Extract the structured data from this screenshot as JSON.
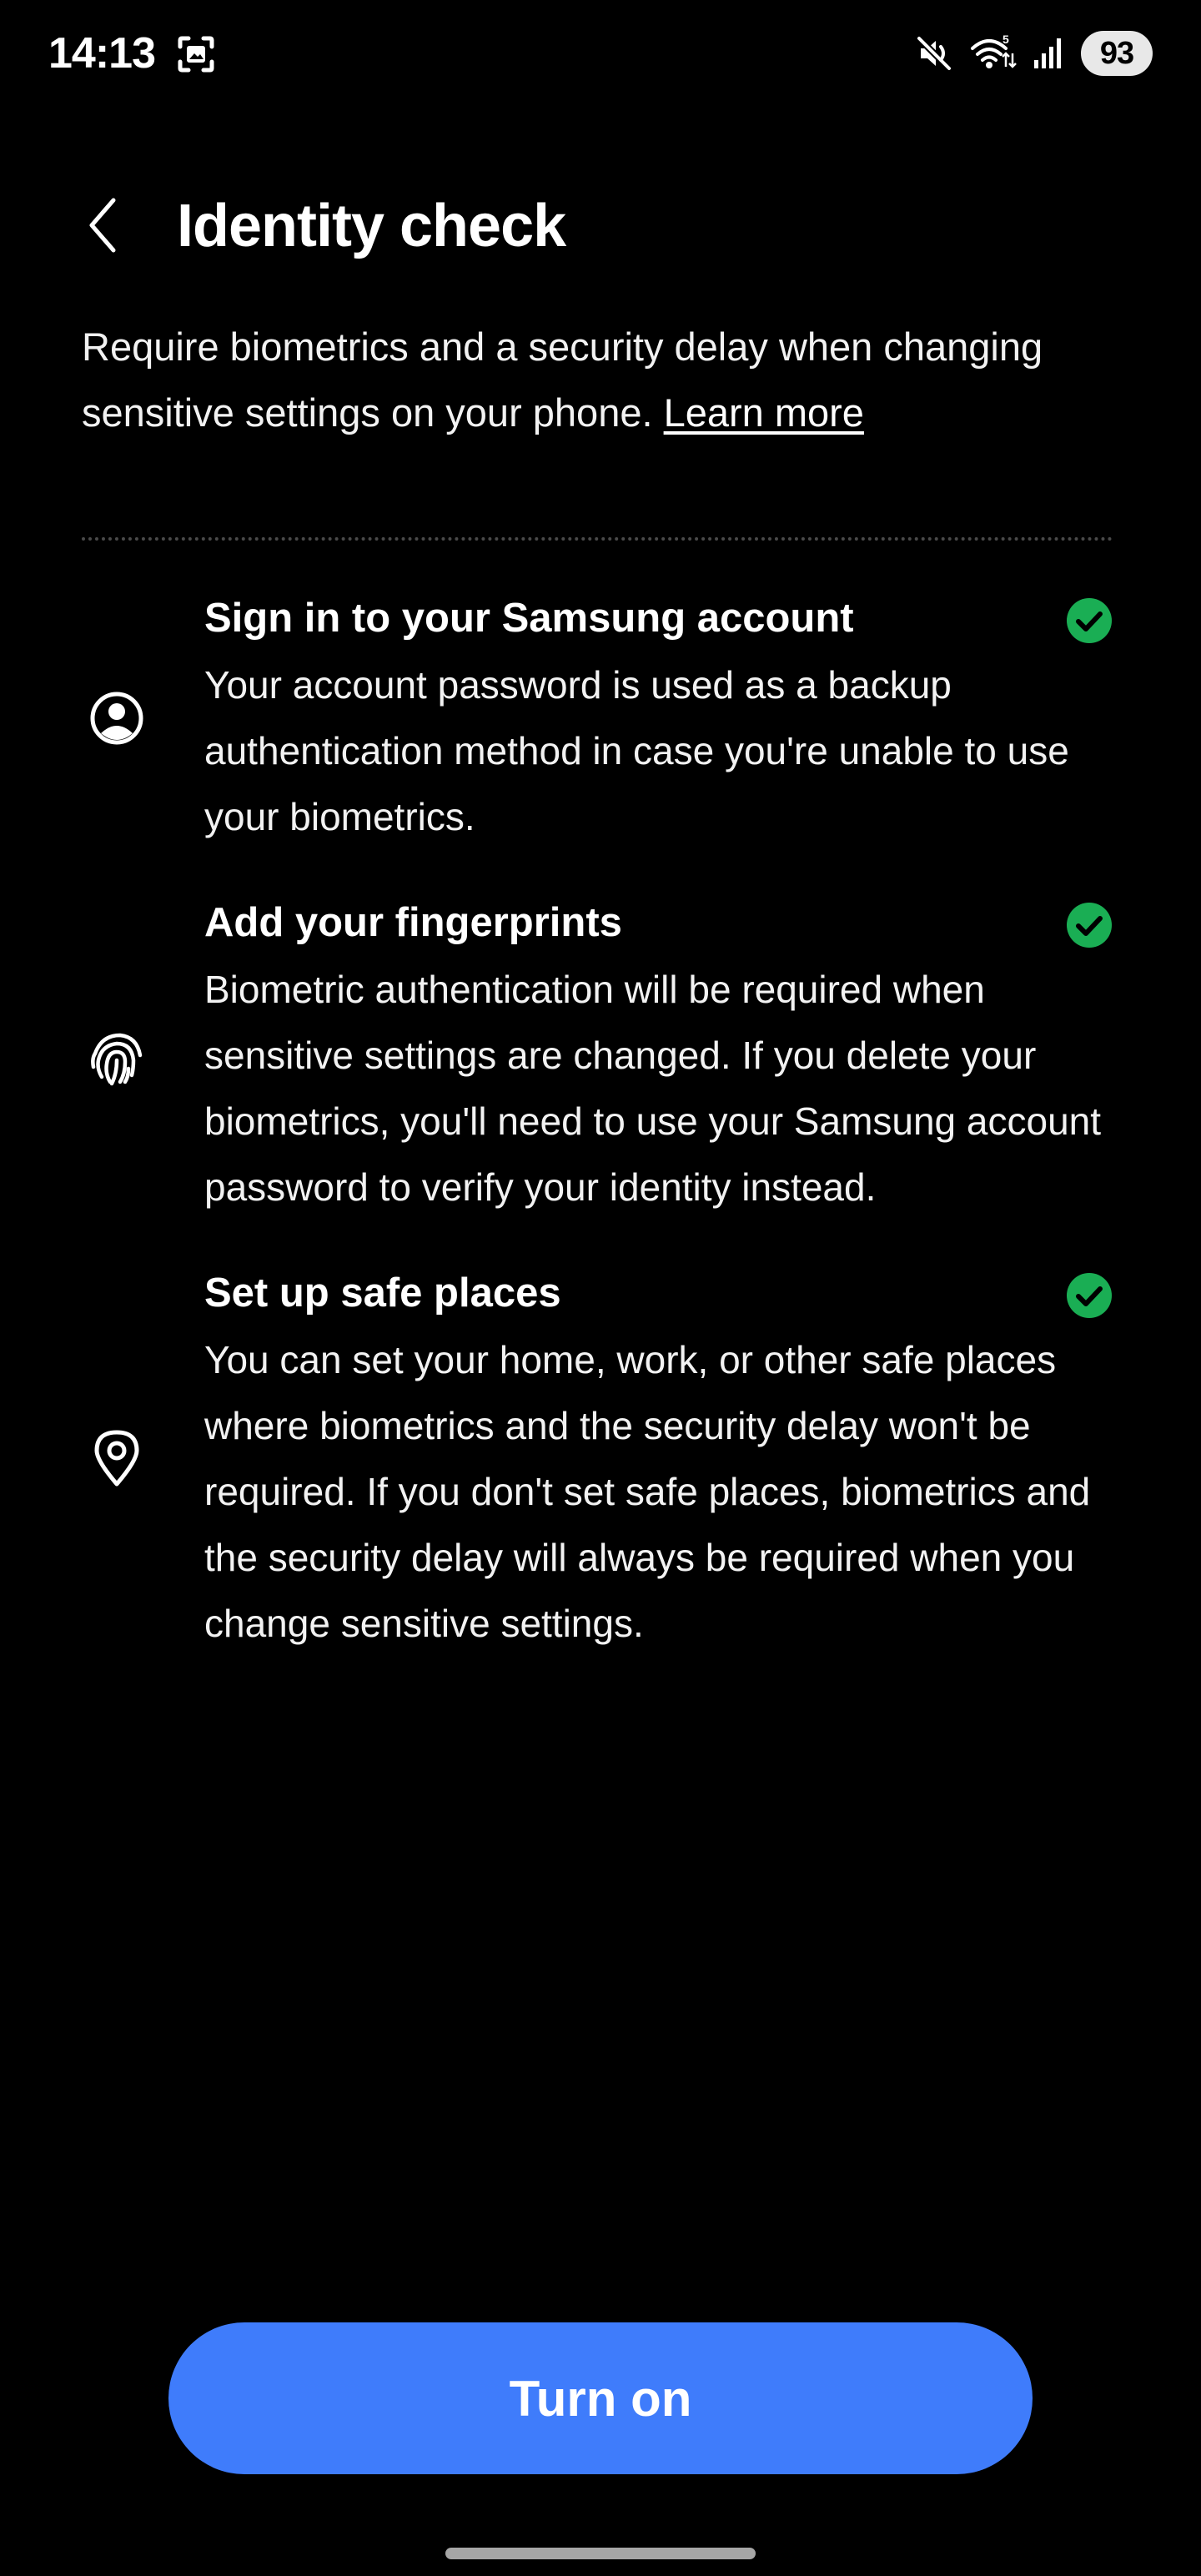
{
  "status_bar": {
    "time": "14:13",
    "battery": "93",
    "icons": [
      "screenshot-icon",
      "mute-icon",
      "wifi-icon",
      "signal-icon",
      "battery-icon"
    ]
  },
  "header": {
    "back_icon": "chevron-left-icon",
    "title": "Identity check"
  },
  "description": {
    "text": "Require biometrics and a security delay when changing sensitive settings on your phone.",
    "learn_more": "Learn more"
  },
  "requirements": [
    {
      "icon": "account-icon",
      "title": "Sign in to your Samsung account",
      "description": "Your account password is used as a backup authentication method in case you're unable to use your biometrics.",
      "status": "complete"
    },
    {
      "icon": "fingerprint-icon",
      "title": "Add your fingerprints",
      "description": "Biometric authentication will be required when sensitive settings are changed. If you delete your biometrics, you'll need to use your Samsung account password to verify your identity instead.",
      "status": "complete"
    },
    {
      "icon": "location-pin-icon",
      "title": "Set up safe places",
      "description": "You can set your home, work, or other safe places where biometrics and the security delay won't be required. If you don't set safe places, biometrics and the security delay will always be required when you change sensitive settings.",
      "status": "complete"
    }
  ],
  "button": {
    "label": "Turn on"
  },
  "colors": {
    "background": "#000000",
    "accent": "#3f7cfb",
    "check": "#1aae54",
    "text": "#ffffff"
  }
}
